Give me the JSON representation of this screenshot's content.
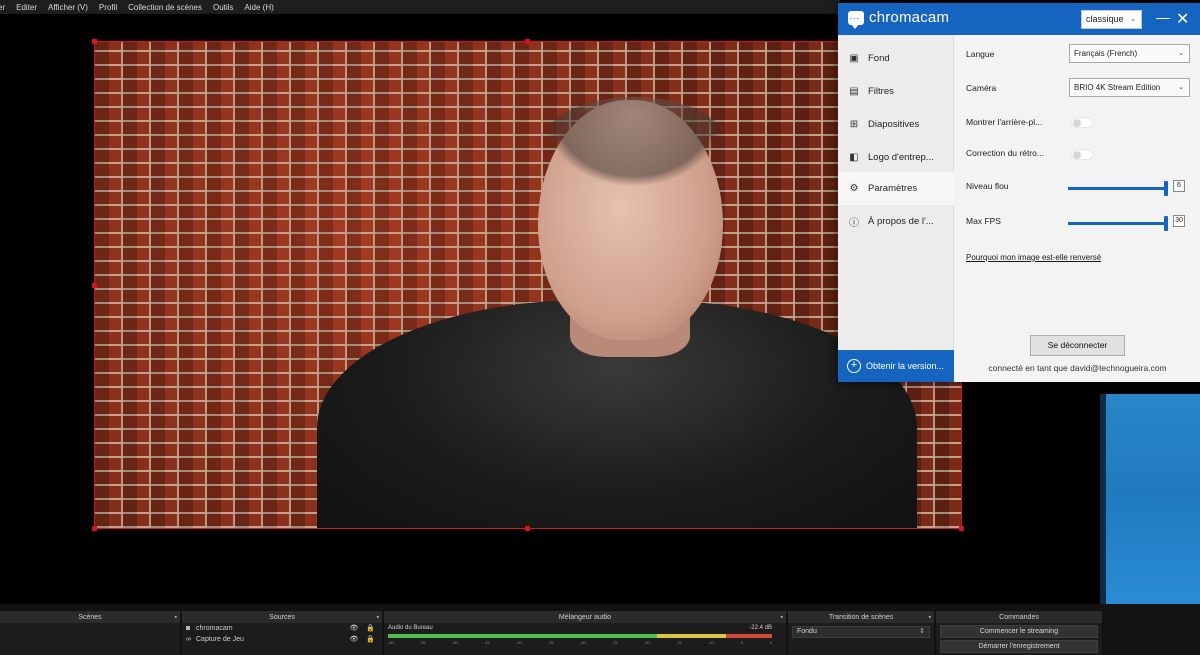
{
  "obs": {
    "menu": [
      "er",
      "Editer",
      "Afficher (V)",
      "Profil",
      "Collection de scènes",
      "Outils",
      "Aide (H)"
    ],
    "docks": {
      "scenes_title": "Scènes",
      "sources_title": "Sources",
      "sources": [
        {
          "icon": "camera-icon",
          "name": "chromacam"
        },
        {
          "icon": "gamepad-icon",
          "name": "Capture de Jeu"
        }
      ],
      "mixer_title": "Mélangeur audio",
      "mixer_channel": "Audio du Bureau",
      "mixer_db": "-22.4 dB",
      "mixer_ticks": [
        "-60",
        "-55",
        "-50",
        "-45",
        "-40",
        "-35",
        "-30",
        "-25",
        "-20",
        "-15",
        "-10",
        "-5",
        "0"
      ],
      "transition_title": "Transition de scènes",
      "transition_value": "Fondu",
      "controls_title": "Commandes",
      "start_streaming": "Commencer le streaming",
      "start_recording": "Démarrer l'enregistrement"
    }
  },
  "chromacam": {
    "brand": "chromacam",
    "theme": "classique",
    "nav": [
      {
        "icon": "image-icon",
        "label": "Fond"
      },
      {
        "icon": "filters-icon",
        "label": "Filtres"
      },
      {
        "icon": "slides-icon",
        "label": "Diapositives"
      },
      {
        "icon": "logo-icon",
        "label": "Logo d'entrep..."
      },
      {
        "icon": "gear-icon",
        "label": "Paramètres"
      },
      {
        "icon": "info-icon",
        "label": "À propos de l'..."
      }
    ],
    "active_nav": "Paramètres",
    "upgrade": "Obtenir la version...",
    "settings": {
      "language_label": "Langue",
      "language_value": "Français (French)",
      "camera_label": "Caméra",
      "camera_value": "BRIO 4K Stream Edition",
      "show_bg_label": "Montrer l'arrière-pl...",
      "show_bg_on": false,
      "correction_label": "Correction du rétro...",
      "correction_on": false,
      "blur_label": "Niveau flou",
      "blur_value": "6",
      "fps_label": "Max FPS",
      "fps_value": "30",
      "mirror_link": "Pourquoi mon image est-elle renversé",
      "disconnect": "Se déconnecter",
      "status": "connecté en tant que david@technogueira.com"
    }
  }
}
